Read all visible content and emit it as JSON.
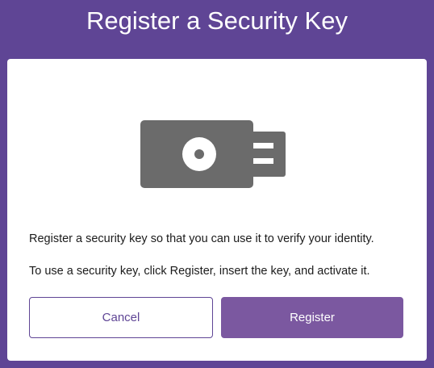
{
  "dialog": {
    "title": "Register a Security Key",
    "description_primary": "Register a security key so that you can use it to verify your identity.",
    "description_secondary": "To use a security key, click Register, insert the key, and activate it.",
    "illustration_icon": "usb-security-key-icon"
  },
  "actions": {
    "cancel_label": "Cancel",
    "register_label": "Register"
  },
  "colors": {
    "background": "#5f4595",
    "card": "#ffffff",
    "primary_button": "#7b58a0",
    "key_icon": "#6b6b6b",
    "text": "#1b1b1b"
  }
}
